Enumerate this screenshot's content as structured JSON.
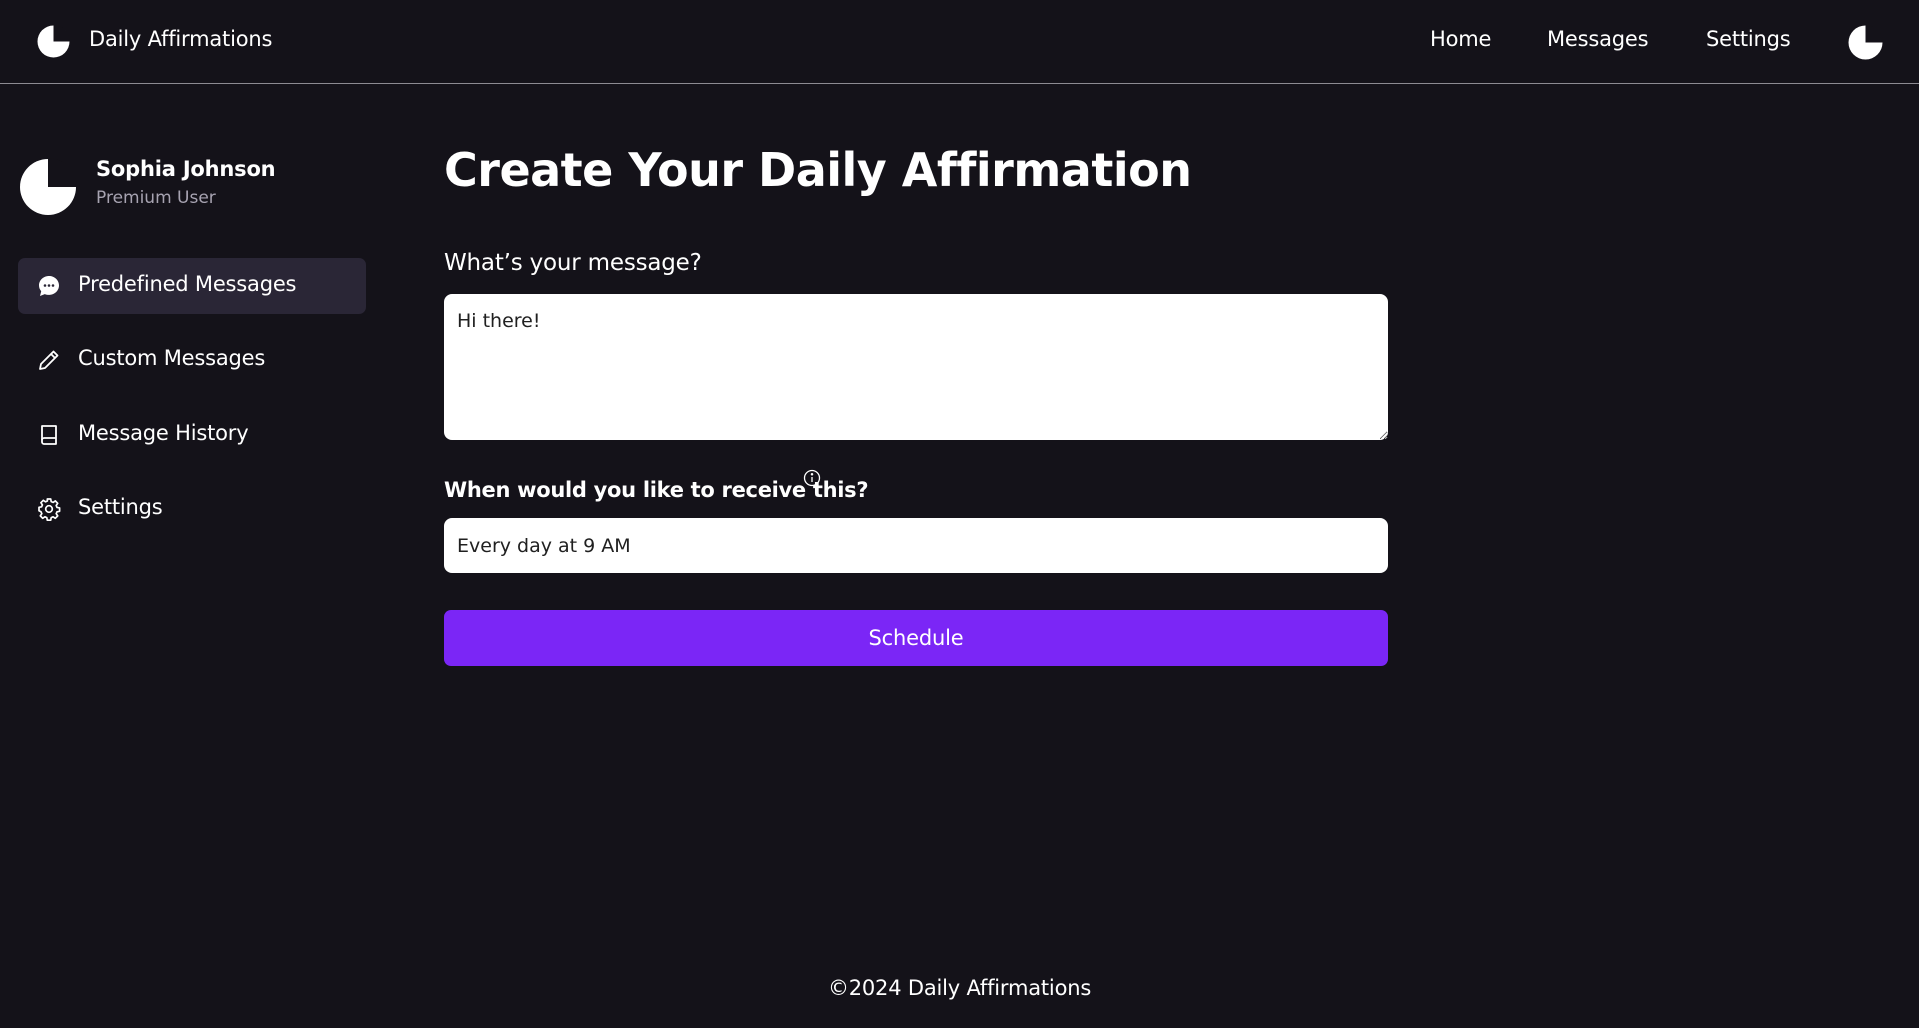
{
  "header": {
    "app_title": "Daily Affirmations",
    "nav": {
      "home": "Home",
      "messages": "Messages",
      "settings": "Settings"
    }
  },
  "profile": {
    "name": "Sophia Johnson",
    "role": "Premium User"
  },
  "sidebar": {
    "items": [
      {
        "label": "Predefined Messages",
        "icon": "chat-bubble-icon",
        "active": true
      },
      {
        "label": "Custom Messages",
        "icon": "pencil-icon",
        "active": false
      },
      {
        "label": "Message History",
        "icon": "book-icon",
        "active": false
      },
      {
        "label": "Settings",
        "icon": "gear-icon",
        "active": false
      }
    ]
  },
  "main": {
    "title": "Create Your Daily Affirmation",
    "message_label": "What’s your message?",
    "message_value": "Hi there!",
    "schedule_label": "When would you like to receive this?",
    "schedule_value": "Every day at 9 AM",
    "schedule_button": "Schedule"
  },
  "footer": {
    "text": "©2024 Daily Affirmations"
  },
  "colors": {
    "background": "#141219",
    "accent": "#7b26f6",
    "active_item": "#2a2636",
    "muted_text": "#a7a3b1"
  }
}
